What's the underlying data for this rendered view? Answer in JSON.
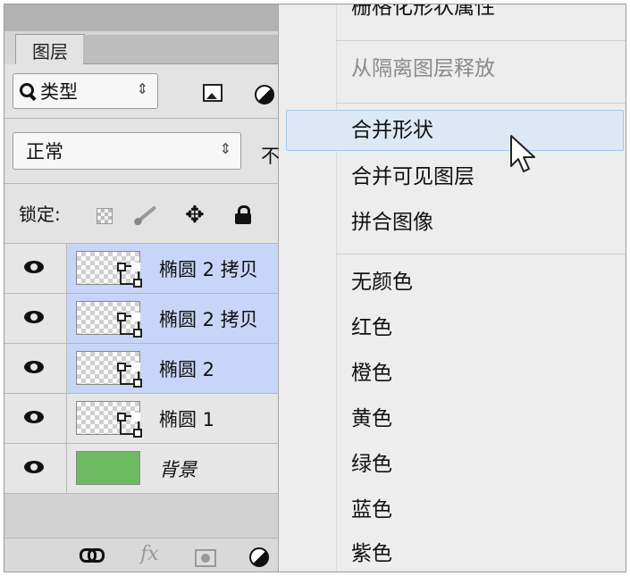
{
  "layers_panel": {
    "tab_label": "图层",
    "filter": {
      "label": "类型",
      "caret": "⇕"
    },
    "blend_mode": {
      "value": "正常",
      "caret": "⇕"
    },
    "opacity_label": "不",
    "lock_label": "锁定:",
    "layers": [
      {
        "name": "椭圆 2 拷贝",
        "selected": true
      },
      {
        "name": "椭圆 2 拷贝",
        "selected": true
      },
      {
        "name": "椭圆 2",
        "selected": true
      },
      {
        "name": "椭圆 1",
        "selected": false
      },
      {
        "name": "背景",
        "selected": false
      }
    ],
    "footer": {
      "fx_label": "fx"
    }
  },
  "context_menu": {
    "items_top": [
      "栅格化形状属性",
      "从隔离图层释放"
    ],
    "items_merge": [
      "合并形状",
      "合并可见图层",
      "拼合图像"
    ],
    "items_colors": [
      "无颜色",
      "红色",
      "橙色",
      "黄色",
      "绿色",
      "蓝色",
      "紫色"
    ],
    "hovered": "合并形状",
    "colors": {
      "highlight_bg": "#dde8f7",
      "highlight_border": "#a9c6ec",
      "selected_layer": "#c7d6f8"
    }
  }
}
